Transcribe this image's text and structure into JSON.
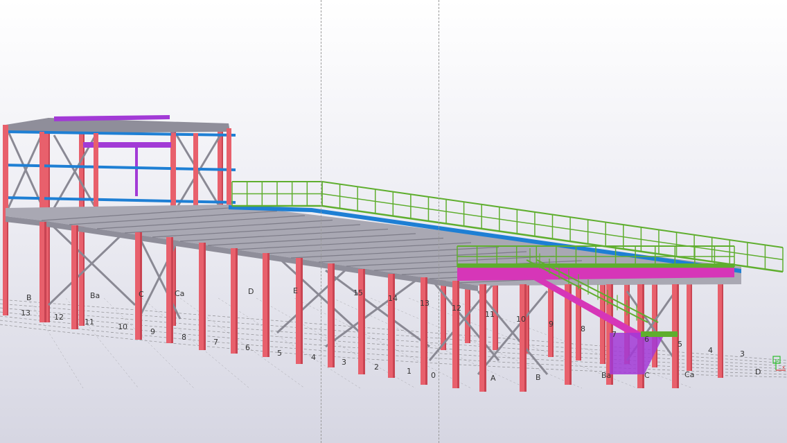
{
  "view": {
    "type": "3d-model-viewport",
    "background_top": "#ffffff",
    "background_bottom": "#d6d6e2"
  },
  "colors": {
    "column": "#e8606c",
    "column_dark": "#c94452",
    "beam": "#8f8e9a",
    "deck": "#a9a8b3",
    "bracing": "#8a8994",
    "railing": "#5fae2e",
    "edge_beam": "#1e7fd4",
    "purple": "#a23ad6",
    "stair": "#d636b8",
    "gridline": "#555555"
  },
  "grid_labels": {
    "left_row": [
      "B",
      "13",
      "12",
      "Ba",
      "11",
      "10",
      "9",
      "C",
      "Ca",
      "8",
      "7",
      "D",
      "6",
      "E",
      "5",
      "4",
      "15",
      "3",
      "14",
      "2",
      "13",
      "1",
      "12",
      "0"
    ],
    "right_row": [
      "11",
      "10",
      "A",
      "9",
      "B",
      "8",
      "Ba",
      "7",
      "C",
      "6",
      "Ca",
      "5",
      "4",
      "D",
      "3"
    ]
  },
  "axis_indicator": {
    "z_label": "z",
    "x_label": "x"
  }
}
